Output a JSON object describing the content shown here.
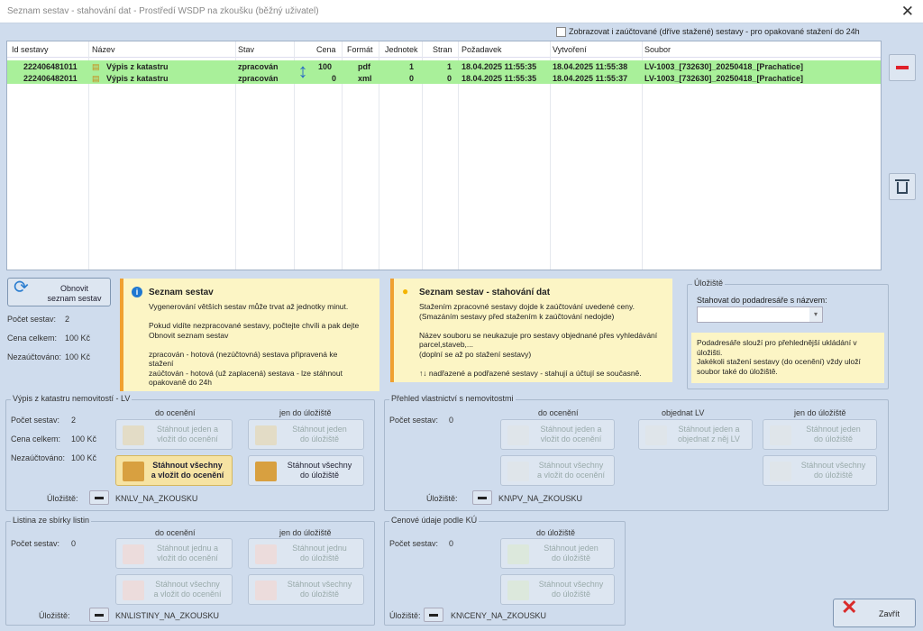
{
  "window": {
    "title": "Seznam sestav - stahování dat - Prostředí WSDP na zkoušku (běžný uživatel)",
    "close_glyph": "✕"
  },
  "show_charged_label": "Zobrazovat i zaúčtované (dříve stažené) sestavy - pro opakované stažení do 24h",
  "table": {
    "columns": [
      "Id sestavy",
      "Název",
      "Stav",
      "Cena",
      "Formát",
      "Jednotek",
      "Stran",
      "Požadavek",
      "Vytvoření",
      "Soubor"
    ],
    "rows": [
      [
        "222406481011",
        "Výpis z katastru",
        "zpracován",
        "100",
        "pdf",
        "1",
        "1",
        "18.04.2025 11:55:35",
        "18.04.2025 11:55:38",
        "LV-1003_[732630]_20250418_[Prachatice]"
      ],
      [
        "222406482011",
        "Výpis z katastru",
        "zpracován",
        "0",
        "xml",
        "0",
        "0",
        "18.04.2025 11:55:35",
        "18.04.2025 11:55:37",
        "LV-1003_[732630]_20250418_[Prachatice]"
      ]
    ]
  },
  "refresh": {
    "label1": "Obnovit",
    "label2": "seznam sestav"
  },
  "stats": {
    "count_label": "Počet sestav:",
    "count": "2",
    "total_label": "Cena celkem:",
    "total": "100 Kč",
    "unbilled_label": "Nezaúčtováno:",
    "unbilled": "100 Kč"
  },
  "info1": {
    "title": "Seznam sestav",
    "lines": [
      "Vygenerování větších sestav může trvat až jednotky minut.",
      "",
      "Pokud vidíte nezpracované sestavy, počtejte chvíli a pak dejte",
      "Obnovit seznam sestav",
      "",
      "zpracován - hotová (nezúčtovná) sestava připravená ke",
      "stažení",
      "zaúčtován - hotová (už zaplacená) sestava - lze stáhnout",
      "opakovaně do 24h"
    ]
  },
  "info2": {
    "title": "Seznam sestav - stahování dat",
    "lines": [
      "Stažením zpracovné sestavy dojde k zaúčtování uvedené ceny.",
      "(Smazáním sestavy před stažením k zaúčtování nedojde)",
      "",
      "Název souboru se neukazuje pro sestavy objednané přes vyhledávání",
      "parcel,staveb,...",
      "(doplní se až po stažení sestavy)",
      "",
      "↑↓ nadřazené a podřazené sestavy - stahují a účtují se současně."
    ]
  },
  "storage": {
    "title": "Úložiště",
    "subdir_label": "Stahovat do podadresáře s názvem:",
    "subdir_value": "",
    "note": [
      "Podadresáře slouží pro přehlednější ukládání v",
      "úložišti.",
      "Jakékoli stažení sestavy (do ocenění) vždy uloží",
      "soubor také do úložiště."
    ]
  },
  "lv": {
    "title": "Výpis z katastru nemovitostí - LV",
    "count_label": "Počet sestav:",
    "count": "2",
    "total_label": "Cena celkem:",
    "total": "100 Kč",
    "unbilled_label": "Nezaúčtováno:",
    "unbilled": "100 Kč",
    "col1": "do ocenění",
    "col2": "jen do úložiště",
    "b1": [
      "Stáhnout jeden a",
      "vložit do ocenění"
    ],
    "b2": [
      "Stáhnout jeden",
      "do úložiště"
    ],
    "b3": [
      "Stáhnout všechny",
      "a vložit do ocenění"
    ],
    "b4": [
      "Stáhnout všechny",
      "do úložiště"
    ],
    "path_label": "Úložiště:",
    "path": "KN\\LV_NA_ZKOUSKU"
  },
  "pv": {
    "title": "Přehled vlastnictví s nemovitostmi",
    "count_label": "Počet sestav:",
    "count": "0",
    "col1": "do ocenění",
    "col2": "objednat LV",
    "col3": "jen do úložiště",
    "b1": [
      "Stáhnout jeden a",
      "vložit do ocenění"
    ],
    "b2": [
      "Stáhnout jeden a",
      "objednat z něj LV"
    ],
    "b3": [
      "Stáhnout jeden",
      "do úložiště"
    ],
    "b4": [
      "Stáhnout všechny",
      "a vložit do ocenění"
    ],
    "b5": [
      "Stáhnout všechny",
      "do úložiště"
    ],
    "path_label": "Úložiště:",
    "path": "KN\\PV_NA_ZKOUSKU"
  },
  "listiny": {
    "title": "Listina ze sbírky listin",
    "count_label": "Počet sestav:",
    "count": "0",
    "col1": "do ocenění",
    "col2": "jen do úložiště",
    "b1": [
      "Stáhnout jednu a",
      "vložit do ocenění"
    ],
    "b2": [
      "Stáhnout jednu",
      "do úložiště"
    ],
    "b3": [
      "Stáhnout všechny",
      "a vložit do ocenění"
    ],
    "b4": [
      "Stáhnout všechny",
      "do úložiště"
    ],
    "path_label": "Úložiště:",
    "path": "KN\\LISTINY_NA_ZKOUSKU"
  },
  "ceny": {
    "title": "Cenové údaje podle KÚ",
    "count_label": "Počet sestav:",
    "count": "0",
    "col1": "do úložiště",
    "b1": [
      "Stáhnout jeden",
      "do úložiště"
    ],
    "b2": [
      "Stáhnout všechny",
      "do úložiště"
    ],
    "path_label": "Úložiště:",
    "path": "KN\\CENY_NA_ZKOUSKU"
  },
  "close_label": "Zavřít"
}
